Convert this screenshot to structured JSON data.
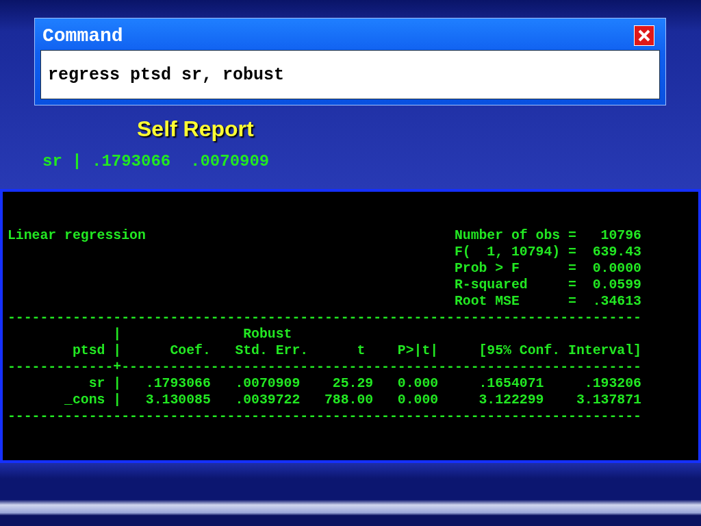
{
  "command_window": {
    "title": "Command",
    "command": "regress ptsd sr, robust"
  },
  "heading": "Self Report",
  "summary_line": "sr | .1793066  .0070909",
  "output_lines": [
    "Linear regression                                      Number of obs =   10796",
    "                                                       F(  1, 10794) =  639.43",
    "                                                       Prob > F      =  0.0000",
    "                                                       R-squared     =  0.0599",
    "                                                       Root MSE      =  .34613",
    "------------------------------------------------------------------------------",
    "             |               Robust",
    "        ptsd |      Coef.   Std. Err.      t    P>|t|     [95% Conf. Interval]",
    "-------------+----------------------------------------------------------------",
    "          sr |   .1793066   .0070909    25.29   0.000     .1654071     .193206",
    "       _cons |   3.130085   .0039722   788.00   0.000     3.122299    3.137871",
    "------------------------------------------------------------------------------"
  ]
}
